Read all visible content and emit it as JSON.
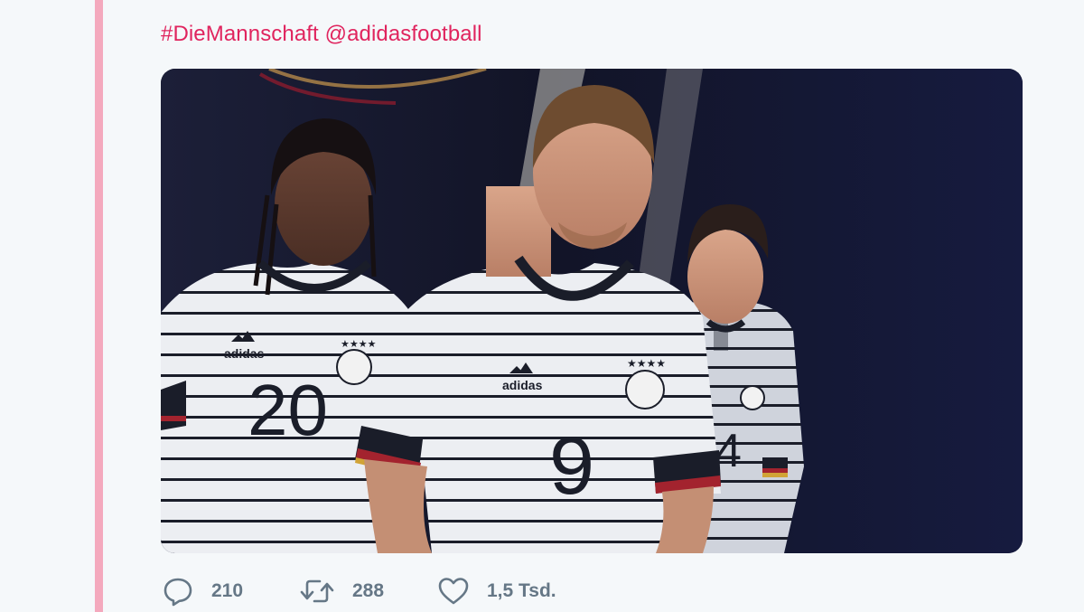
{
  "tweet": {
    "text_parts": [
      "#DieMannschaft",
      "@adidasfootball"
    ],
    "link_color": "#e0245e",
    "accent_color": "#f4a9bd"
  },
  "media": {
    "type": "photo",
    "shirt_numbers": [
      "20",
      "9",
      "4"
    ],
    "brand_texts": [
      "adidas",
      "adidas"
    ]
  },
  "actions": {
    "reply": {
      "icon": "reply-bubble-icon",
      "count": "210"
    },
    "retweet": {
      "icon": "retweet-icon",
      "count": "288"
    },
    "like": {
      "icon": "heart-icon",
      "count": "1,5 Tsd."
    }
  }
}
